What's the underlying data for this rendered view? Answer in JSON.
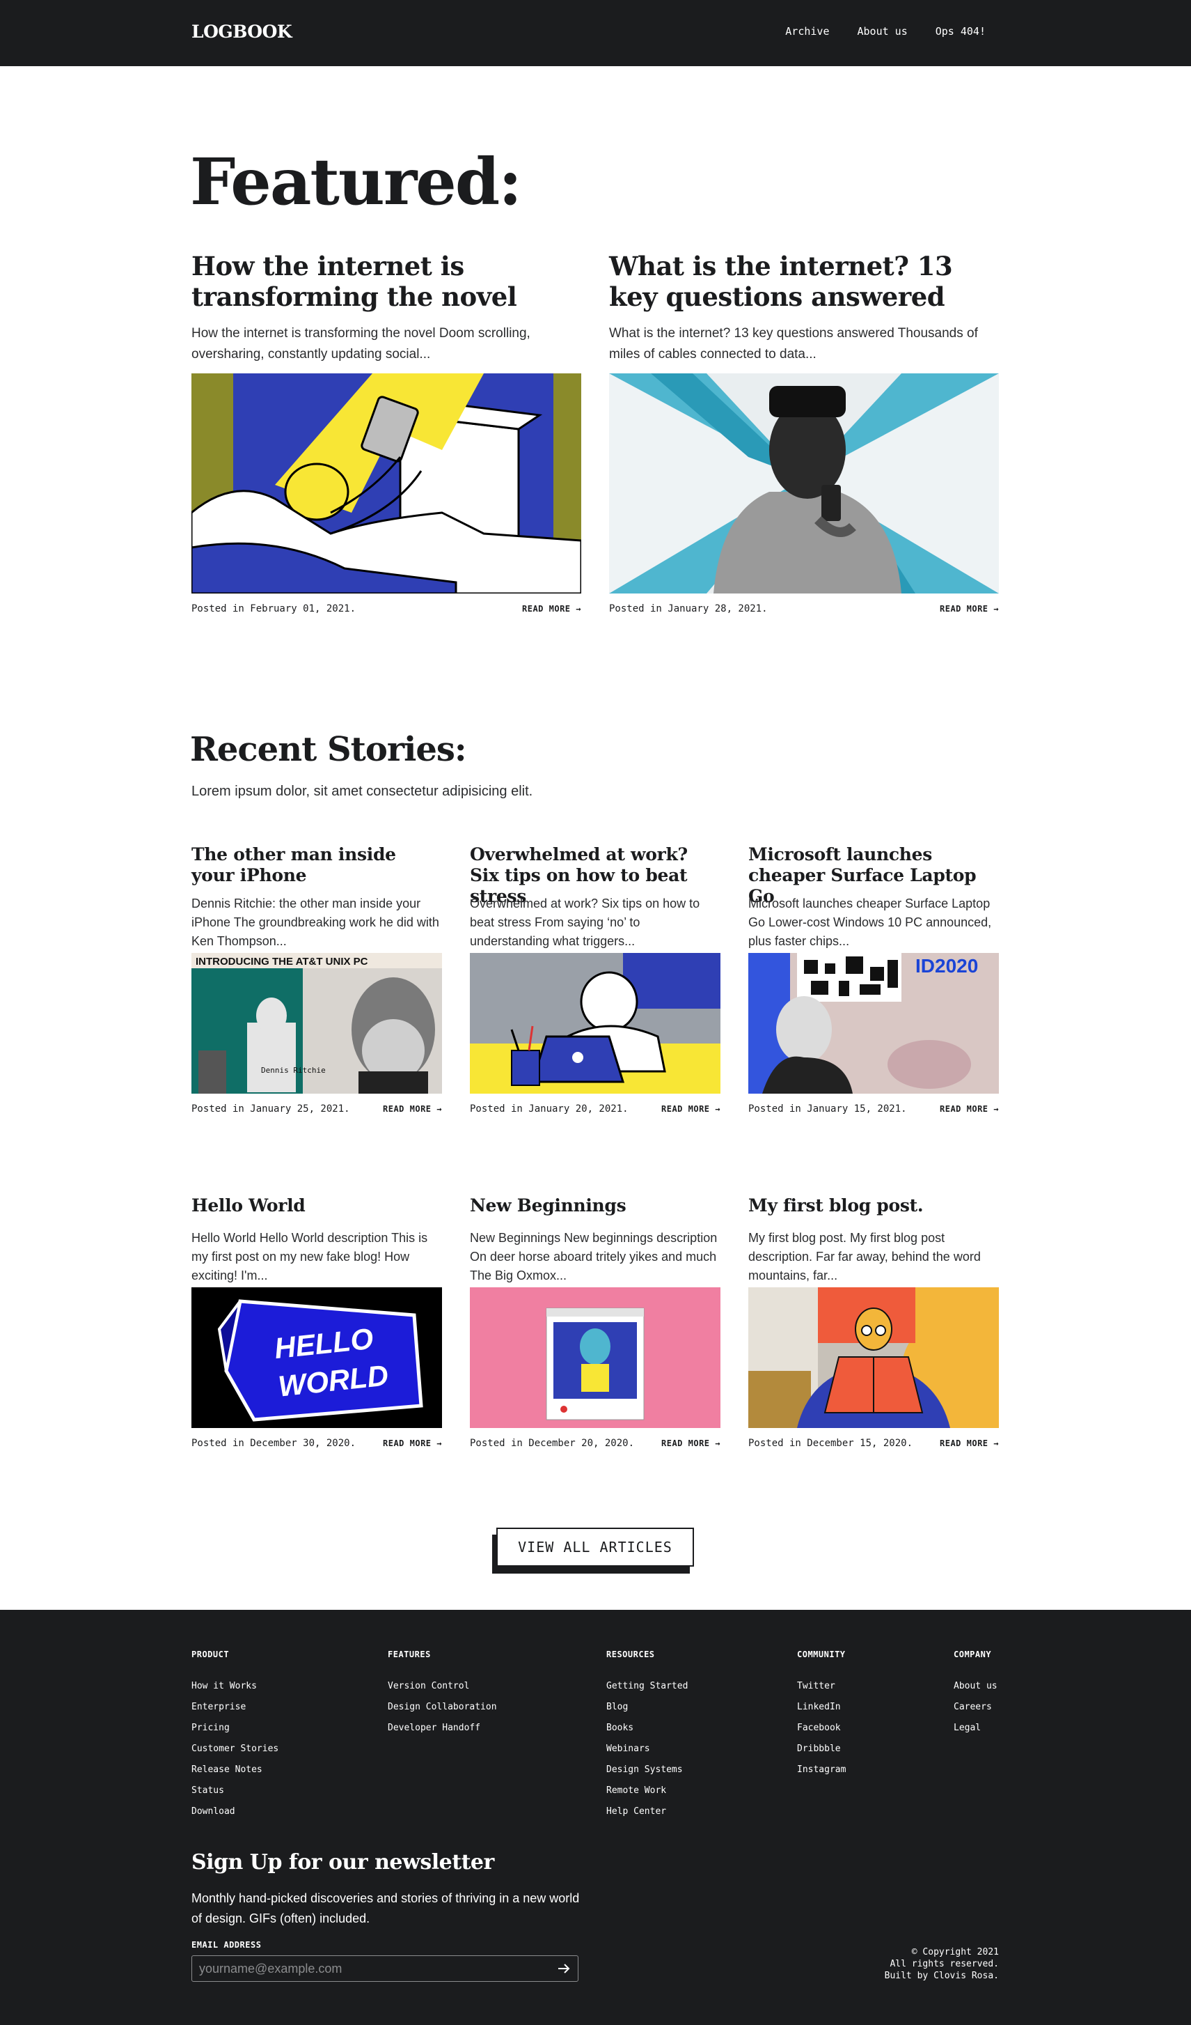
{
  "header": {
    "logo": "LOGBOOK",
    "nav": [
      "Archive",
      "About us",
      "Ops 404!"
    ]
  },
  "featured": {
    "title": "Featured:",
    "posts": [
      {
        "title": "How the internet is transforming the novel",
        "excerpt": "How the internet is transforming the novel Doom scrolling, oversharing, constantly updating social...",
        "date": "Posted in February 01, 2021.",
        "more": "READ MORE"
      },
      {
        "title": "What is the internet? 13 key questions answered",
        "excerpt": "What is the internet? 13 key questions answered Thousands of miles of cables connected to data...",
        "date": "Posted in January 28, 2021.",
        "more": "READ MORE"
      }
    ]
  },
  "recent": {
    "title": "Recent Stories:",
    "subtitle": "Lorem ipsum dolor, sit amet consectetur adipisicing elit.",
    "posts": [
      {
        "title": "The other man inside your iPhone",
        "excerpt": "Dennis Ritchie: the other man inside your iPhone The groundbreaking work he did with Ken Thompson...",
        "date": "Posted in January 25, 2021.",
        "more": "READ MORE",
        "img_text_1": "INTRODUCING  THE AT&T UNIX PC",
        "img_text_2": "Dennis Ritchie"
      },
      {
        "title": "Overwhelmed at work? Six tips on how to beat stress",
        "excerpt": "Overwhelmed at work? Six tips on how to beat stress From saying ‘no’ to understanding what triggers...",
        "date": "Posted in January 20, 2021.",
        "more": "READ MORE"
      },
      {
        "title": "Microsoft launches cheaper Surface Laptop Go",
        "excerpt": "Microsoft launches cheaper Surface Laptop Go Lower-cost Windows 10 PC announced, plus faster chips...",
        "date": "Posted in January 15, 2021.",
        "more": "READ MORE",
        "img_text_1": "ID2020"
      },
      {
        "title": "Hello World",
        "excerpt": "Hello World Hello World description This is my first post on my new fake blog! How exciting! I'm...",
        "date": "Posted in December 30, 2020.",
        "more": "READ MORE",
        "img_text_1": "HELLO",
        "img_text_2": "WORLD"
      },
      {
        "title": "New Beginnings",
        "excerpt": "New Beginnings New beginnings description On deer horse aboard tritely yikes and much The Big Oxmox...",
        "date": "Posted in December 20, 2020.",
        "more": "READ MORE"
      },
      {
        "title": "My first blog post.",
        "excerpt": "My first blog post. My first blog post description. Far far away, behind the word mountains, far...",
        "date": "Posted in December 15, 2020.",
        "more": "READ MORE"
      }
    ]
  },
  "view_all": "VIEW ALL ARTICLES",
  "footer": {
    "columns": [
      {
        "heading": "PRODUCT",
        "links": [
          "How it Works",
          "Enterprise",
          "Pricing",
          "Customer Stories",
          "Release Notes",
          "Status",
          "Download"
        ]
      },
      {
        "heading": "FEATURES",
        "links": [
          "Version Control",
          "Design Collaboration",
          "Developer Handoff"
        ]
      },
      {
        "heading": "RESOURCES",
        "links": [
          "Getting Started",
          "Blog",
          "Books",
          "Webinars",
          "Design Systems",
          "Remote Work",
          "Help Center"
        ]
      },
      {
        "heading": "COMMUNITY",
        "links": [
          "Twitter",
          "LinkedIn",
          "Facebook",
          "Dribbble",
          "Instagram"
        ]
      },
      {
        "heading": "COMPANY",
        "links": [
          "About us",
          "Careers",
          "Legal"
        ]
      }
    ],
    "newsletter": {
      "title": "Sign Up for our newsletter",
      "description": "Monthly hand-picked discoveries and stories of thriving in a new world of design. GIFs (often) included.",
      "email_label": "EMAIL ADDRESS",
      "email_placeholder": "yourname@example.com"
    },
    "copyright": [
      "© Copyright 2021",
      "All rights reserved.",
      "Built by Clovis Rosa."
    ]
  },
  "colors": {
    "ink": "#1b1c1e",
    "blue": "#2f3fb4",
    "yellow": "#f8e635",
    "teal": "#0f6e66",
    "sky": "#4fb6cf",
    "pink": "#f07fa1"
  }
}
